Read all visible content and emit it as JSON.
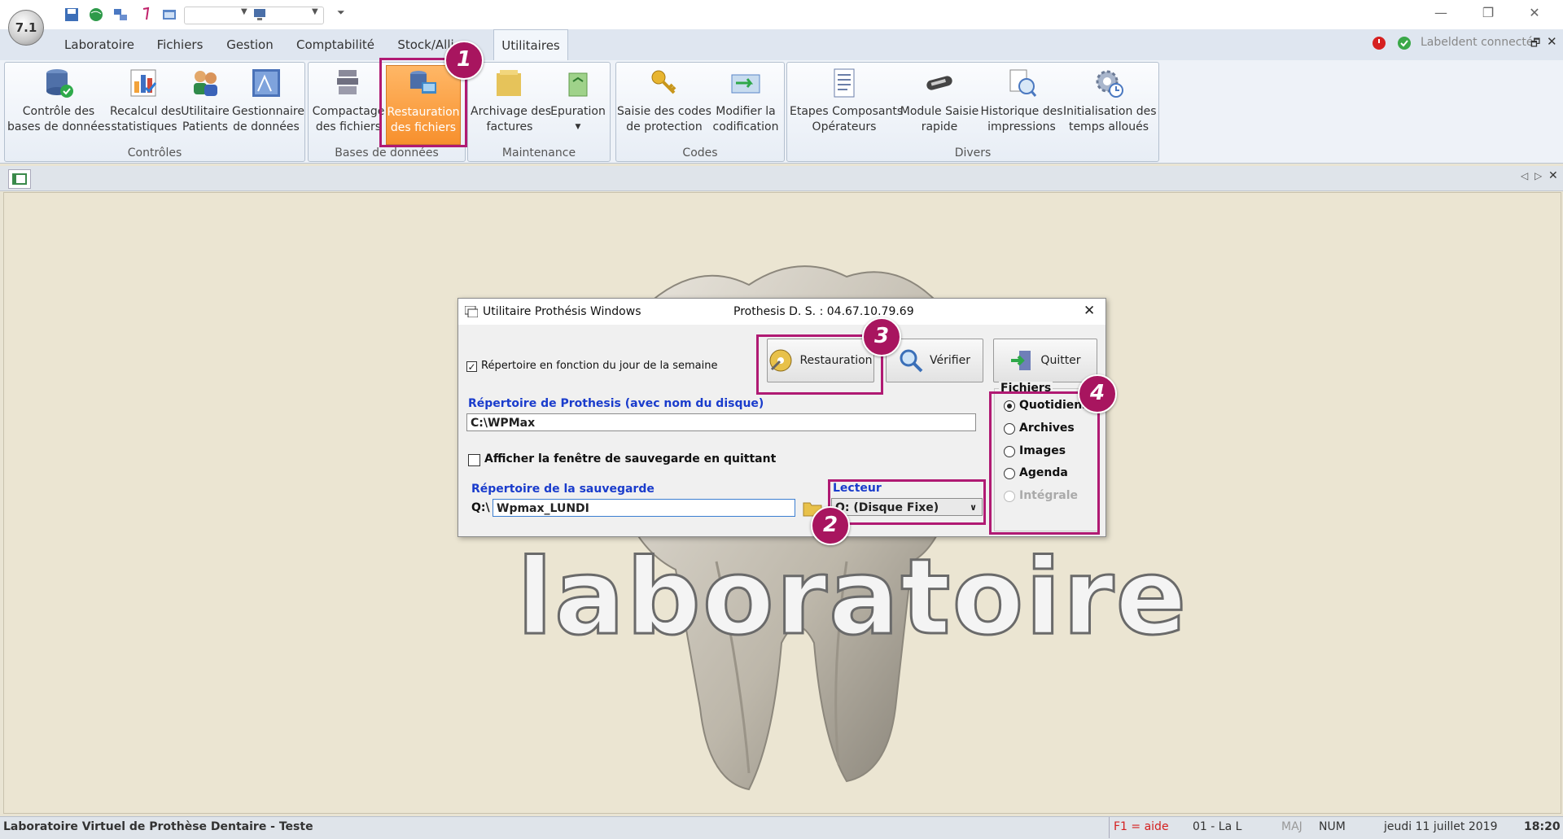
{
  "app": {
    "logo_text": "7.1"
  },
  "menu": {
    "tabs": [
      "Laboratoire",
      "Fichiers",
      "Gestion",
      "Comptabilité",
      "Stock/Alli",
      "Utilitaires"
    ],
    "connection_status": "Labeldent connecté"
  },
  "ribbon": {
    "groups": [
      "Contrôles",
      "Bases de données",
      "Maintenance",
      "Codes",
      "Divers"
    ],
    "buttons": [
      {
        "l1": "Contrôle des",
        "l2": "bases de données"
      },
      {
        "l1": "Recalcul des",
        "l2": "statistiques"
      },
      {
        "l1": "Utilitaire",
        "l2": "Patients"
      },
      {
        "l1": "Gestionnaire",
        "l2": "de données"
      },
      {
        "l1": "Compactage",
        "l2": "des fichiers"
      },
      {
        "l1": "Restauration",
        "l2": "des fichiers"
      },
      {
        "l1": "Archivage des",
        "l2": "factures"
      },
      {
        "l1": "Epuration",
        "l2": ""
      },
      {
        "l1": "Saisie des codes",
        "l2": "de protection"
      },
      {
        "l1": "Modifier la",
        "l2": "codification"
      },
      {
        "l1": "Etapes Composants",
        "l2": "Opérateurs"
      },
      {
        "l1": "Module Saisie",
        "l2": "rapide"
      },
      {
        "l1": "Historique des",
        "l2": "impressions"
      },
      {
        "l1": "Initialisation des",
        "l2": "temps alloués"
      }
    ]
  },
  "workspace": {
    "background_text": "laboratoire"
  },
  "dialog": {
    "title": "Utilitaire Prothésis Windows",
    "subtitle": "Prothesis D. S. : 04.67.10.79.69",
    "checkbox_weekday": "Répertoire en fonction du jour de la semaine",
    "prothesis_dir_label": "Répertoire de Prothesis (avec nom du disque)",
    "prothesis_dir_value": "C:\\WPMax",
    "checkbox_show_save": "Afficher la fenêtre de sauvegarde en quittant",
    "backup_dir_label": "Répertoire de la sauvegarde",
    "backup_drive_prefix": "Q:\\",
    "backup_dir_value": "Wpmax_LUNDI",
    "reader_label": "Lecteur",
    "reader_value": "Q: (Disque Fixe)",
    "btn_restore": "Restauration",
    "btn_verify": "Vérifier",
    "btn_quit": "Quitter",
    "files_group": "Fichiers",
    "file_options": [
      "Quotidiens",
      "Archives",
      "Images",
      "Agenda",
      "Intégrale"
    ]
  },
  "badges": [
    "1",
    "2",
    "3",
    "4"
  ],
  "statusbar": {
    "left": "Laboratoire Virtuel de Prothèse Dentaire - Teste",
    "help": "F1 = aide",
    "code": "01 - La L",
    "caps": "MAJ",
    "num": "NUM",
    "date": "jeudi 11 juillet 2019",
    "time": "18:20"
  },
  "colors": {
    "highlight": "#b01a73",
    "badge": "#a8155f",
    "ribbon_active": "#f7902d",
    "label_blue": "#1a3ccc"
  }
}
